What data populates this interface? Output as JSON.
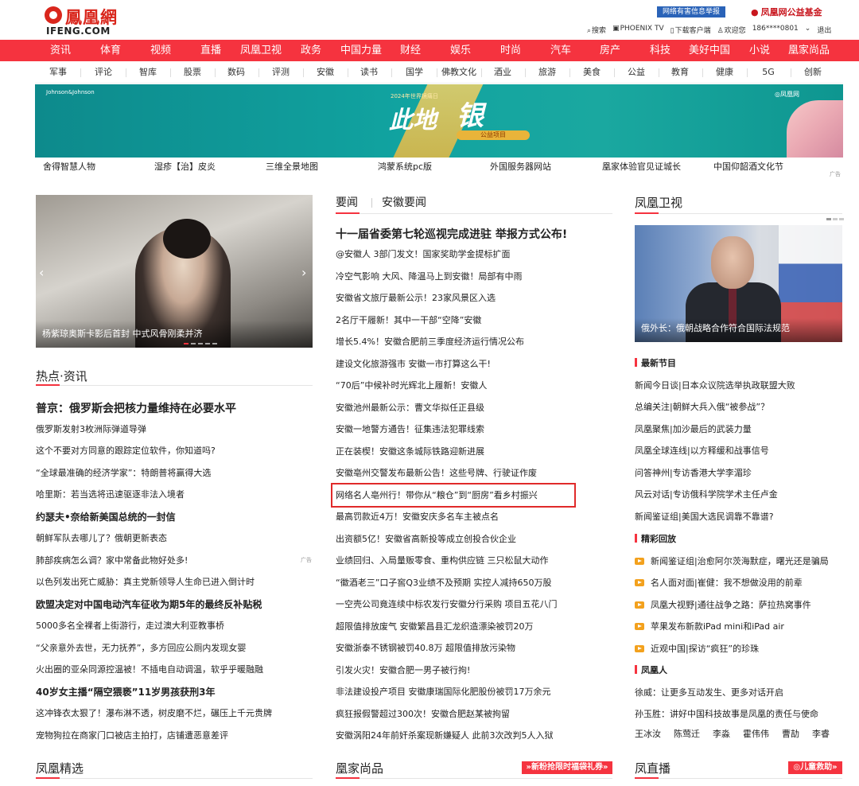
{
  "header": {
    "logo_cn": "鳳凰網",
    "logo_en": "IFENG.COM",
    "report": "网络有害信息举报",
    "fund": "凤凰网公益基金",
    "user_bar": [
      "搜索",
      "PHOENIX TV",
      "下载客户端",
      "欢迎您",
      "186****0801",
      "退出"
    ]
  },
  "nav_main": [
    "资讯",
    "体育",
    "视频",
    "直播",
    "凤凰卫视",
    "政务",
    "中国力量",
    "财经",
    "娱乐",
    "时尚",
    "汽车",
    "房产",
    "科技",
    "美好中国",
    "小说",
    "凰家尚品"
  ],
  "nav_sub": [
    "军事",
    "评论",
    "智库",
    "股票",
    "数码",
    "评测",
    "安徽",
    "读书",
    "国学",
    "佛教文化",
    "酒业",
    "旅游",
    "美食",
    "公益",
    "教育",
    "健康",
    "5G",
    "创新"
  ],
  "banner": {
    "brand": "Johnson&Johnson",
    "year_text": "2024年世界镜痛日",
    "title_a": "此地",
    "title_b": "银",
    "pill": "公益项目",
    "mark": "◎凤凰网"
  },
  "link_row": [
    "舍得智慧人物",
    "湿疹【治】皮炎",
    "三维全景地图",
    "鸿蒙系统pc版",
    "外国服务器网站",
    "凰家体验官见证城长",
    "中国仰韶酒文化节"
  ],
  "ad_label": "广告",
  "slider": {
    "caption": "杨紫琼奥斯卡影后首封 中式风骨刚柔并济",
    "prev": "‹",
    "next": "›"
  },
  "hot": {
    "title": "热点·资讯",
    "items": [
      {
        "text": "普京：俄罗斯会把核力量维持在必要水平",
        "style": "headline"
      },
      {
        "text": "俄罗斯发射3枚洲际弹道导弹",
        "style": ""
      },
      {
        "text": "这个不要对方同意的跟踪定位软件，你知道吗?",
        "style": ""
      },
      {
        "text": "“全球最准确的经济学家”：特朗普将赢得大选",
        "style": ""
      },
      {
        "text": "哈里斯：若当选将迅速驱逐非法入境者",
        "style": ""
      },
      {
        "text": "约瑟夫•奈给新美国总统的一封信",
        "style": "bold"
      },
      {
        "text": "朝鲜军队去哪儿了？俄朝更新表态",
        "style": ""
      },
      {
        "text": "肺部疾病怎么调？家中常备此物好处多!",
        "style": ""
      },
      {
        "text": "以色列发出死亡威胁：真主党新领导人生命已进入倒计时",
        "style": ""
      },
      {
        "text": "欧盟决定对中国电动汽车征收为期5年的最终反补贴税",
        "style": "bold"
      },
      {
        "text": "5000多名全裸者上街游行，走过澳大利亚教事桥",
        "style": ""
      },
      {
        "text": "“父亲意外去世，无力抚养”，多方回应公厕内发现女婴",
        "style": ""
      },
      {
        "text": "火出圈的亚朵同源控温被！不插电自动调温，软乎乎暖融融",
        "style": ""
      },
      {
        "text": "40岁女主播“隔空猥亵”11岁男孩获刑3年",
        "style": "bold"
      },
      {
        "text": "这冲锋衣太狠了！瀑布淋不透，树皮磨不烂，碾压上千元贵牌",
        "style": ""
      },
      {
        "text": "宠物狗拉在商家门口被店主拍打，店铺遭恶意差评",
        "style": ""
      }
    ]
  },
  "news": {
    "tabs": [
      "要闻",
      "安徽要闻"
    ],
    "items": [
      {
        "text": "十一届省委第七轮巡视完成进驻 举报方式公布!",
        "style": "headline"
      },
      {
        "text": "@安徽人 3部门发文！国家奖助学金提标扩面",
        "style": ""
      },
      {
        "text": "冷空气影响 大风、降温马上到安徽！局部有中雨",
        "style": ""
      },
      {
        "text": "安徽省文旅厅最新公示！23家风景区入选",
        "style": ""
      },
      {
        "text": "2名厅干履新！其中一干部“空降”安徽",
        "style": ""
      },
      {
        "text": "增长5.4%！安徽合肥前三季度经济运行情况公布",
        "style": ""
      },
      {
        "text": "建设文化旅游强市 安徽一市打算这么干!",
        "style": ""
      },
      {
        "text": "“70后”中候补时光辉北上履新！安徽人",
        "style": ""
      },
      {
        "text": "安徽池州最新公示：曹文华拟任正县级",
        "style": ""
      },
      {
        "text": "安徽一地警方通告！征集违法犯罪线索",
        "style": ""
      },
      {
        "text": "正在装楔！安徽这条城际铁路迎新进展",
        "style": ""
      },
      {
        "text": "安徽亳州交警发布最新公告！这些号牌、行驶证作废",
        "style": ""
      },
      {
        "text": "网络名人亳州行！带你从“粮仓”到“厨房”看乡村振兴",
        "style": ""
      },
      {
        "text": "最高罚款近4万！安徽安庆多名车主被点名",
        "style": ""
      },
      {
        "text": "出资额5亿！安徽省高新投等成立创投合伙企业",
        "style": ""
      },
      {
        "text": "业绩回归、入局量贩零食、重构供应链 三只松鼠大动作",
        "style": ""
      },
      {
        "text": "“徽酒老三”口子窖Q3业绩不及预期 实控人减持650万股",
        "style": ""
      },
      {
        "text": "一空壳公司竟连续中标农发行安徽分行采购 项目五花八门",
        "style": ""
      },
      {
        "text": "超限值排放废气 安徽繁昌县汇龙织造漂染被罚20万",
        "style": ""
      },
      {
        "text": "安徽浙泰不锈钢被罚40.8万 超限值排放污染物",
        "style": ""
      },
      {
        "text": "引发火灾！安徽合肥一男子被行拘!",
        "style": ""
      },
      {
        "text": "非法建设投产项目 安徽康瑞国际化肥股份被罚17万余元",
        "style": ""
      },
      {
        "text": "疯狂报假警超过300次！安徽合肥赵某被拘留",
        "style": ""
      },
      {
        "text": "安徽涡阳24年前奸杀案现新嫌疑人 此前3次改判5人入狱",
        "style": ""
      }
    ]
  },
  "tv": {
    "title": "凤凰卫视",
    "caption": "俄外长：俄朝战略合作符合国际法规范",
    "latest_title": "最新节目",
    "latest": [
      "新闻今日谈|日本众议院选举执政联盟大败",
      "总编关注|朝鲜大兵入俄“被参战”？",
      "凤凰聚焦|加沙最后的武装力量",
      "凤凰全球连线|以方释缓和战事信号",
      "问答神州|专访香港大学李湄珍",
      "风云对话|专访俄科学院学术主任卢金",
      "新闻鉴证组|美国大选民调靠不靠谱?"
    ],
    "replay_title": "精彩回放",
    "replay": [
      "新闻鉴证组|治愈阿尔茨海默症，曙光还是骗局",
      "名人面对面|崔健：我不想做没用的前辈",
      "凤凰大视野|通往战争之路：萨拉热窝事件",
      "苹果发布新款iPad mini和iPad air",
      "近观中国|探访“疯狂”的珍珠"
    ],
    "people_title": "凤凰人",
    "people_lines": [
      "徐威：让更多互动发生、更多对话开启",
      "孙玉胜：讲好中国科技故事是凤凰的责任与使命"
    ],
    "names": [
      "王冰汝",
      "陈莺迁",
      "李淼",
      "霍伟伟",
      "曹劼",
      "李睿"
    ]
  },
  "bottom": {
    "left_title": "凤凰精选",
    "mid_title": "凰家尚品",
    "mid_promo": "»新粉抢限时福袋礼券»",
    "right_title": "凤直播",
    "right_promo": "◎儿童救助»"
  }
}
